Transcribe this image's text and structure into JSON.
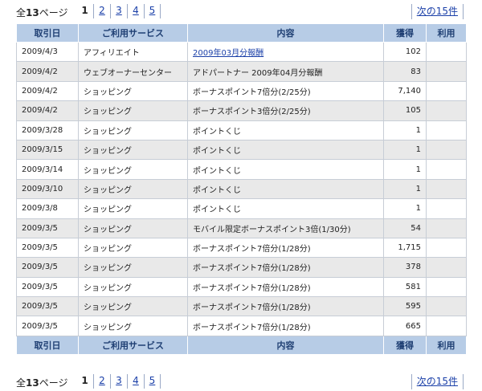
{
  "pager": {
    "total_prefix": "全",
    "total_count": "13",
    "total_suffix": "ページ",
    "current": "1",
    "pages": [
      "2",
      "3",
      "4",
      "5"
    ],
    "next_label": "次の15件"
  },
  "table": {
    "headers": [
      "取引日",
      "ご利用サービス",
      "内容",
      "獲得",
      "利用"
    ],
    "rows": [
      {
        "date": "2009/4/3",
        "service": "アフィリエイト",
        "content": "2009年03月分報酬",
        "earned": "102",
        "used": "",
        "is_link": true
      },
      {
        "date": "2009/4/2",
        "service": "ウェブオーナーセンター",
        "content": "アドパートナー 2009年04月分報酬",
        "earned": "83",
        "used": ""
      },
      {
        "date": "2009/4/2",
        "service": "ショッピング",
        "content": "ボーナスポイント7倍分(2/25分)",
        "earned": "7,140",
        "used": ""
      },
      {
        "date": "2009/4/2",
        "service": "ショッピング",
        "content": "ボーナスポイント3倍分(2/25分)",
        "earned": "105",
        "used": ""
      },
      {
        "date": "2009/3/28",
        "service": "ショッピング",
        "content": "ポイントくじ",
        "earned": "1",
        "used": ""
      },
      {
        "date": "2009/3/15",
        "service": "ショッピング",
        "content": "ポイントくじ",
        "earned": "1",
        "used": ""
      },
      {
        "date": "2009/3/14",
        "service": "ショッピング",
        "content": "ポイントくじ",
        "earned": "1",
        "used": ""
      },
      {
        "date": "2009/3/10",
        "service": "ショッピング",
        "content": "ポイントくじ",
        "earned": "1",
        "used": ""
      },
      {
        "date": "2009/3/8",
        "service": "ショッピング",
        "content": "ポイントくじ",
        "earned": "1",
        "used": ""
      },
      {
        "date": "2009/3/5",
        "service": "ショッピング",
        "content": "モバイル限定ボーナスポイント3倍(1/30分)",
        "earned": "54",
        "used": ""
      },
      {
        "date": "2009/3/5",
        "service": "ショッピング",
        "content": "ボーナスポイント7倍分(1/28分)",
        "earned": "1,715",
        "used": ""
      },
      {
        "date": "2009/3/5",
        "service": "ショッピング",
        "content": "ボーナスポイント7倍分(1/28分)",
        "earned": "378",
        "used": ""
      },
      {
        "date": "2009/3/5",
        "service": "ショッピング",
        "content": "ボーナスポイント7倍分(1/28分)",
        "earned": "581",
        "used": ""
      },
      {
        "date": "2009/3/5",
        "service": "ショッピング",
        "content": "ボーナスポイント7倍分(1/28分)",
        "earned": "595",
        "used": ""
      },
      {
        "date": "2009/3/5",
        "service": "ショッピング",
        "content": "ボーナスポイント7倍分(1/28分)",
        "earned": "665",
        "used": ""
      }
    ]
  },
  "colors": {
    "header_bg": "#b7cce6",
    "header_text": "#1f3f73",
    "row_alt_bg": "#e9e9e9",
    "link": "#1a3fa8"
  }
}
